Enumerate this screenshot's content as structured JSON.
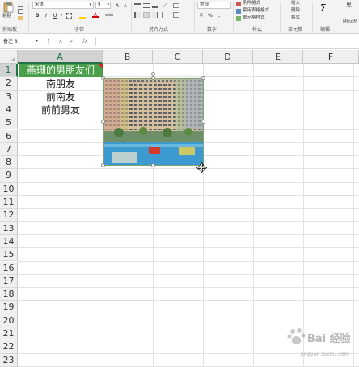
{
  "ribbon": {
    "clipboard": {
      "paste_label": "粘贴",
      "group_label": "剪贴板"
    },
    "font": {
      "font_name": "宋体",
      "font_size": "9",
      "bold": "B",
      "italic": "I",
      "underline": "U",
      "group_label": "字体"
    },
    "alignment": {
      "group_label": "对齐方式"
    },
    "number": {
      "format_value": "常规",
      "group_label": "数字"
    },
    "styles": {
      "conditional_format": "条件格式",
      "table_format": "套用表格格式",
      "cell_styles": "单元格样式",
      "group_label": "样式"
    },
    "cells": {
      "insert": "插入",
      "delete": "删除",
      "format": "格式",
      "group_label": "单元格"
    },
    "editing": {
      "group_label": "编辑"
    },
    "mindfull": {
      "label_top": "思",
      "label": "MindM"
    }
  },
  "formula_bar": {
    "name_box": "备注 8",
    "cancel_icon": "×",
    "enter_icon": "✓",
    "fx_label": "fx",
    "content": ""
  },
  "sheet": {
    "columns": [
      "A",
      "B",
      "C",
      "D",
      "E",
      "F"
    ],
    "rows": [
      "1",
      "2",
      "3",
      "4",
      "5",
      "6",
      "7",
      "8",
      "9",
      "10",
      "11",
      "12",
      "13",
      "14",
      "15",
      "16",
      "17",
      "18",
      "19",
      "20",
      "21",
      "22",
      "23"
    ],
    "cells": {
      "A1": "燕珊的男朋友们",
      "A2": "南朋友",
      "A3": "前南友",
      "A4": "前前男友"
    },
    "accent_color": "#217346",
    "header_fill_color": "#4aa04a"
  },
  "watermark": {
    "text": "Bai 经验",
    "sub": "jingyan.baidu.com"
  }
}
